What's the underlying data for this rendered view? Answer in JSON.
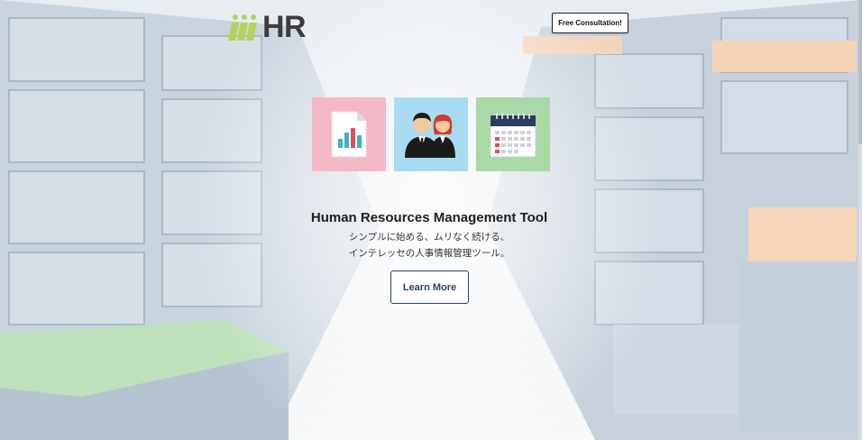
{
  "header": {
    "logo_text": "HR",
    "consult_label": "Free Consultation!"
  },
  "hero": {
    "title": "Human Resources Management Tool",
    "subtitle_line1": "シンプルに始める、ムリなく続ける、",
    "subtitle_line2": "インテレッセの人事情報管理ツール。",
    "cta_label": "Learn More"
  },
  "feature_icons": [
    {
      "name": "report-chart-icon",
      "tile_color": "#f4b8c6"
    },
    {
      "name": "people-icon",
      "tile_color": "#a8dcf3"
    },
    {
      "name": "calendar-icon",
      "tile_color": "#a9d9a6"
    }
  ],
  "colors": {
    "logo_green": "#b5d35a",
    "logo_text": "#3d3d3d",
    "cta_border": "#2c3e63"
  }
}
